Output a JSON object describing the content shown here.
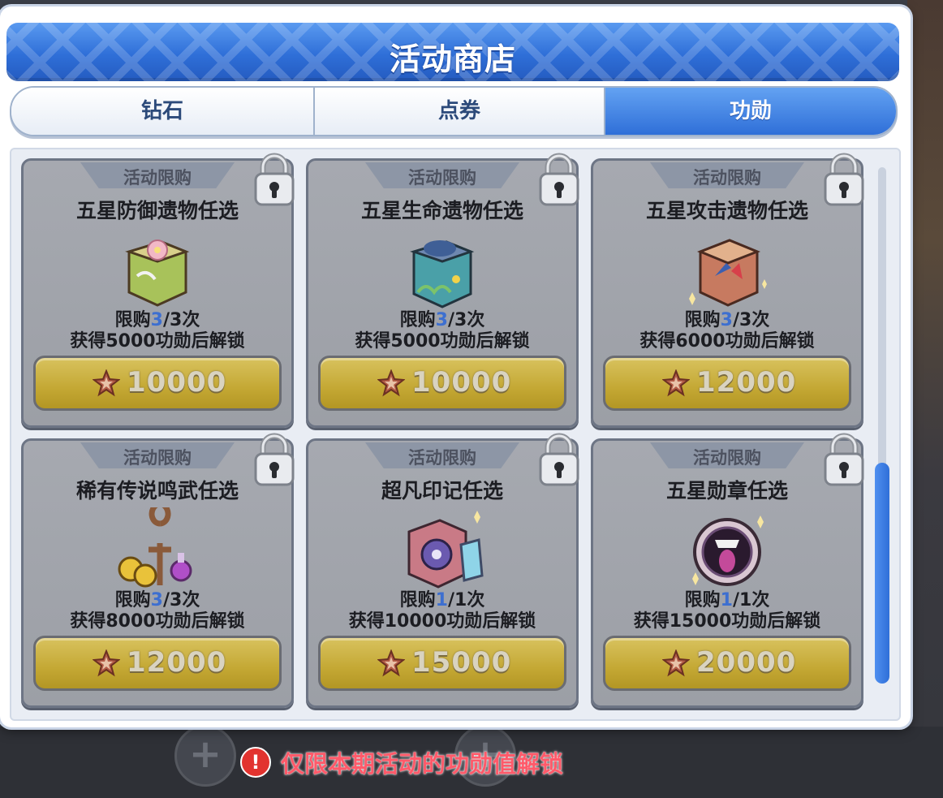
{
  "shop": {
    "title": "活动商店",
    "tabs": [
      {
        "label": "钻石",
        "active": false
      },
      {
        "label": "点券",
        "active": false
      },
      {
        "label": "功勋",
        "active": true
      }
    ]
  },
  "items": [
    {
      "tag": "活动限购",
      "name": "五星防御遗物任选",
      "limit_prefix": "限购",
      "limit_used": "3",
      "limit_total": "/3次",
      "unlock": "获得5000功勋后解锁",
      "price": "10000",
      "icon": "cherry-blossom-relic-box-icon",
      "locked": true
    },
    {
      "tag": "活动限购",
      "name": "五星生命遗物任选",
      "limit_prefix": "限购",
      "limit_used": "3",
      "limit_total": "/3次",
      "unlock": "获得5000功勋后解锁",
      "price": "10000",
      "icon": "ocean-relic-box-icon",
      "locked": true
    },
    {
      "tag": "活动限购",
      "name": "五星攻击遗物任选",
      "limit_prefix": "限购",
      "limit_used": "3",
      "limit_total": "/3次",
      "unlock": "获得6000功勋后解锁",
      "price": "12000",
      "icon": "attack-relic-box-icon",
      "locked": true
    },
    {
      "tag": "活动限购",
      "name": "稀有传说鸣武任选",
      "limit_prefix": "限购",
      "limit_used": "3",
      "limit_total": "/3次",
      "unlock": "获得8000功勋后解锁",
      "price": "12000",
      "icon": "ankh-coins-potions-icon",
      "locked": true
    },
    {
      "tag": "活动限购",
      "name": "超凡印记任选",
      "limit_prefix": "限购",
      "limit_used": "1",
      "limit_total": "/1次",
      "unlock": "获得10000功勋后解锁",
      "price": "15000",
      "icon": "seal-crystal-box-icon",
      "locked": true
    },
    {
      "tag": "活动限购",
      "name": "五星勋章任选",
      "limit_prefix": "限购",
      "limit_used": "1",
      "limit_total": "/1次",
      "unlock": "获得15000功勋后解锁",
      "price": "20000",
      "icon": "medal-badge-icon",
      "locked": true
    }
  ],
  "notice": {
    "text": "仅限本期活动的功勋值解锁",
    "icon": "warning-icon"
  },
  "colors": {
    "accent": "#2f6fd8",
    "limit_number": "#3d6fd0",
    "notice": "#ff5a6a",
    "price_button": "#c4a834"
  }
}
